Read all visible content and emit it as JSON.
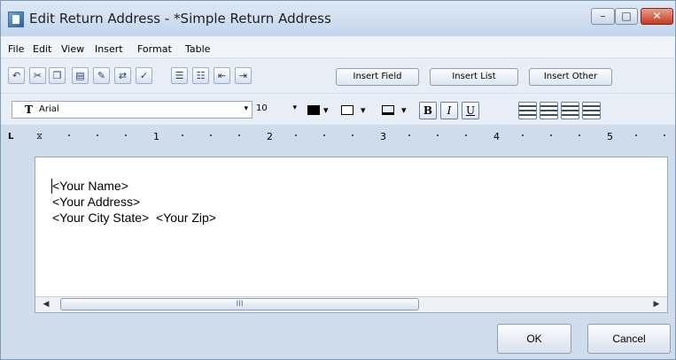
{
  "window": {
    "title": "Edit Return Address - *Simple Return Address",
    "minimize_glyph": "–",
    "maximize_glyph": "□",
    "close_glyph": "✕"
  },
  "menu": [
    "File",
    "Edit",
    "View",
    "Insert",
    "Format",
    "Table"
  ],
  "toolbar": {
    "icons": [
      "undo-icon",
      "cut-icon",
      "copy-icon",
      "paste-icon",
      "clear-formatting-icon",
      "find-replace-icon",
      "spellcheck-icon",
      "bullets-icon",
      "numbering-icon",
      "outdent-icon",
      "indent-icon"
    ],
    "buttons": [
      "Insert Field",
      "Insert List",
      "Insert Other"
    ]
  },
  "format_bar": {
    "font": "Arial",
    "font_glyph": "T",
    "size": "10",
    "arrow": "▾",
    "text_color": "#000000",
    "bold": "B",
    "italic": "I",
    "underline": "U"
  },
  "ruler": {
    "tab_marker": "L",
    "numbers": [
      "1",
      "2",
      "3",
      "4",
      "5"
    ]
  },
  "editor": {
    "lines": [
      "<Your Name>",
      "<Your Address>",
      "<Your City State>  <Your Zip>"
    ],
    "scroll_thumb_glyph": "III",
    "left_arrow": "◀",
    "right_arrow": "▶"
  },
  "buttons": {
    "ok": "OK",
    "cancel": "Cancel"
  },
  "colors": {
    "window_bg": "#cfdcec",
    "close_red": "#c23a1f"
  }
}
